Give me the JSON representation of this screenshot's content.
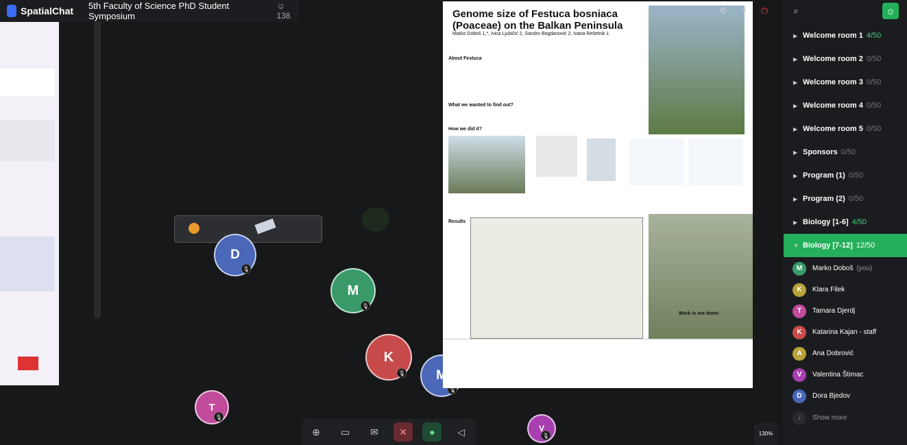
{
  "app": {
    "name": "SpatialChat",
    "event_title": "5th Faculty of Science PhD Student Symposium",
    "participant_count": "138"
  },
  "poster": {
    "title": "Genome size of Festuca bosniaca (Poaceae) on the Balkan Peninsula",
    "authors": "Marko Doboš 1,*, Ivica Ljubičić 2, Sandro Bogdanović 2, Ivana Rešetnik 1",
    "sections": [
      "About Festuca",
      "What we wanted to find out?",
      "How we did it?",
      "Results",
      "Work is not done!"
    ]
  },
  "avatars": [
    {
      "letter": "D",
      "color": "#4a67b8"
    },
    {
      "letter": "M",
      "color": "#3a9a6a"
    },
    {
      "letter": "K",
      "color": "#c84b4b"
    },
    {
      "letter": "M",
      "color": "#4a67b8"
    },
    {
      "letter": "T",
      "color": "#c24a9a"
    },
    {
      "letter": "V",
      "color": "#a83fb0"
    }
  ],
  "sidebar": {
    "rooms": [
      {
        "name": "Welcome room 1",
        "count": "4/50",
        "active": false,
        "highlight": true
      },
      {
        "name": "Welcome room 2",
        "count": "0/50",
        "active": false,
        "highlight": false
      },
      {
        "name": "Welcome room 3",
        "count": "0/50",
        "active": false,
        "highlight": false
      },
      {
        "name": "Welcome room 4",
        "count": "0/50",
        "active": false,
        "highlight": false
      },
      {
        "name": "Welcome room 5",
        "count": "0/50",
        "active": false,
        "highlight": false
      },
      {
        "name": "Sponsors",
        "count": "0/50",
        "active": false,
        "highlight": false
      },
      {
        "name": "Program (1)",
        "count": "0/50",
        "active": false,
        "highlight": false
      },
      {
        "name": "Program (2)",
        "count": "0/50",
        "active": false,
        "highlight": false
      },
      {
        "name": "Biology [1-6]",
        "count": "4/50",
        "active": false,
        "highlight": true
      },
      {
        "name": "Biology [7-12]",
        "count": "12/50",
        "active": true,
        "highlight": false
      }
    ],
    "members": [
      {
        "initial": "M",
        "name": "Marko Doboš",
        "you": "(you)",
        "color": "#3a9a6a"
      },
      {
        "initial": "K",
        "name": "Klara Filek",
        "you": "",
        "color": "#b8a23a"
      },
      {
        "initial": "T",
        "name": "Tamara Djerdj",
        "you": "",
        "color": "#c24a9a"
      },
      {
        "initial": "K",
        "name": "Katarina Kajan - staff",
        "you": "",
        "color": "#c84b4b"
      },
      {
        "initial": "A",
        "name": "Ana Dobrović",
        "you": "",
        "color": "#b8a23a"
      },
      {
        "initial": "V",
        "name": "Valentina Štimac",
        "you": "",
        "color": "#a83fb0"
      },
      {
        "initial": "D",
        "name": "Dora Bjedov",
        "you": "",
        "color": "#4a67b8"
      }
    ],
    "show_more": "Show more"
  },
  "zoom": "130%"
}
